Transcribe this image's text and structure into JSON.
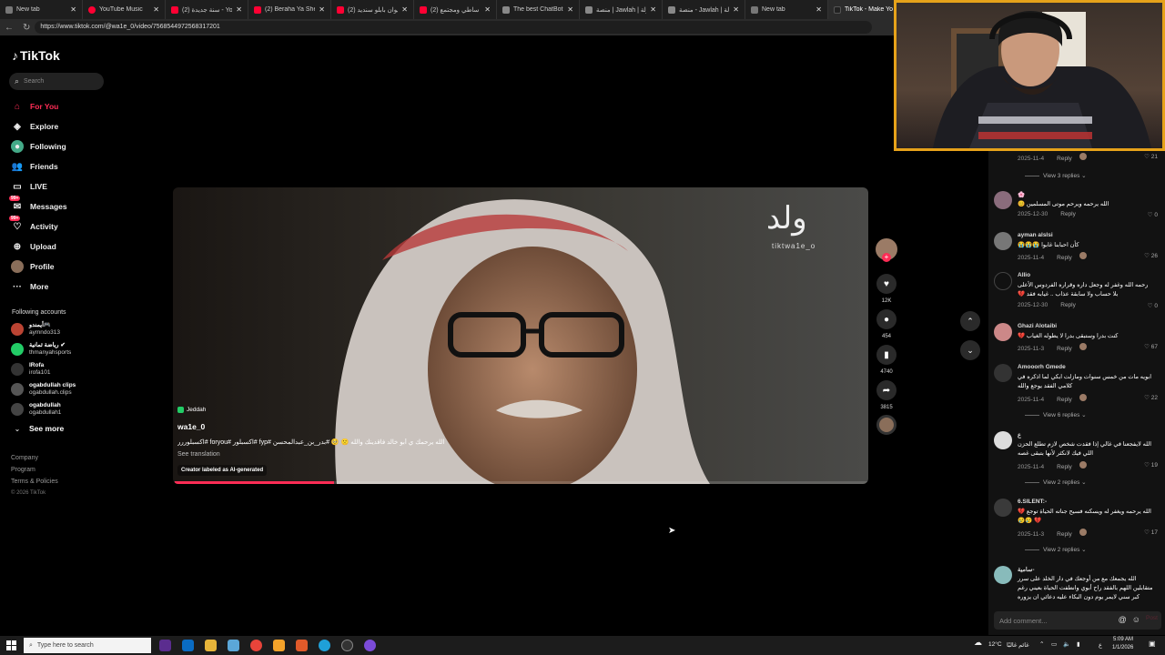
{
  "browser": {
    "tabs": [
      {
        "label": "New tab",
        "color": "#777"
      },
      {
        "label": "YouTube Music",
        "color": "#ff0033"
      },
      {
        "label": "(2) سنة جديدة - YouTube",
        "color": "#ff0033"
      },
      {
        "label": "(2) Beraha Ya Sheekh",
        "color": "#ff0033"
      },
      {
        "label": "(2) ميوان بابلو سنديد",
        "color": "#ff0033"
      },
      {
        "label": "(2) بلاك ساطي ومجتمع",
        "color": "#ff0033"
      },
      {
        "label": "The best ChatBot and",
        "color": "#888"
      },
      {
        "label": "منصة | Jawlah | جولة",
        "color": "#888"
      },
      {
        "label": "منصة - Jawlah | جولة",
        "color": "#888"
      },
      {
        "label": "New tab",
        "color": "#777"
      },
      {
        "label": "TikTok - Make Your D",
        "color": "#222",
        "active": true
      }
    ],
    "url": "https://www.tiktok.com/@wa1e_0/video/7568544972568317201"
  },
  "sidebar": {
    "logo": "TikTok",
    "search_placeholder": "Search",
    "nav": [
      {
        "label": "For You",
        "icon": "home-icon",
        "active": true
      },
      {
        "label": "Explore",
        "icon": "compass-icon"
      },
      {
        "label": "Following",
        "icon": "following-icon"
      },
      {
        "label": "Friends",
        "icon": "friends-icon"
      },
      {
        "label": "LIVE",
        "icon": "live-icon"
      },
      {
        "label": "Messages",
        "icon": "messages-icon",
        "badge": "99+"
      },
      {
        "label": "Activity",
        "icon": "activity-icon",
        "badge": "99+"
      },
      {
        "label": "Upload",
        "icon": "upload-icon"
      },
      {
        "label": "Profile",
        "icon": "profile-icon"
      },
      {
        "label": "More",
        "icon": "more-icon"
      }
    ],
    "following_title": "Following accounts",
    "accounts": [
      {
        "name": "أيمندو🎮",
        "handle": "aymndo313"
      },
      {
        "name": "رياضة ثمانية ✔",
        "handle": "thmanyahsports"
      },
      {
        "name": "IRofa",
        "handle": "irofa101"
      },
      {
        "name": "ogabdullah clips",
        "handle": "ogabdullah.clips"
      },
      {
        "name": "ogabdullah",
        "handle": "ogabdullah1"
      }
    ],
    "see_more": "See more",
    "footer": [
      "Company",
      "Program",
      "Terms & Policies",
      "© 2026 TikTok"
    ]
  },
  "video": {
    "watermark": "tiktwa1e_o",
    "location": "Jeddah",
    "author": "wa1e_0",
    "caption": "الله يرحمك ي أبو خالد فاقدينك والله 🙁 🥺 #بدر_بن_عبدالمحسن #fyp #اكسبلور #foryou #اكسبلوررر",
    "see_translation": "See translation",
    "ai_label": "Creator labeled as AI-generated",
    "progress_fraction": 0.23
  },
  "actions": {
    "likes": "12K",
    "comments": "454",
    "saves": "4740",
    "shares": "3815"
  },
  "comments": {
    "top_meta": {
      "date": "2025-11-4",
      "reply": "Reply",
      "likes": "21",
      "more": "View 3 replies"
    },
    "items": [
      {
        "name": "🌸",
        "text": "الله يرحمه ويرحم موتى المسلمين 😊",
        "date": "2025-12-30",
        "reply": "Reply",
        "likes": "0"
      },
      {
        "name": "ayman alslsi",
        "text": "كأن احبابنا غابوا 😭😭😭",
        "date": "2025-11-4",
        "reply": "Reply",
        "likes": "26"
      },
      {
        "name": "Allio",
        "text": "رحمه الله وغفر له وجعل داره وقراره الفردوس الأعلى بلا حساب ولا سابقة عذاب .. غيابه فقد 💔",
        "date": "2025-12-30",
        "reply": "Reply",
        "likes": "0"
      },
      {
        "name": "Ghazi Alotaibi",
        "text": "كنت بدرا وستبقى بدرا لا يطوله الغياب 💔",
        "date": "2025-11-3",
        "reply": "Reply",
        "likes": "67"
      },
      {
        "name": "Amooorh Gmede",
        "text": "ابويه مات من خمس سنوات ومازلت ابكي لما اذكره في كلامي الفقد يوجع والله",
        "date": "2025-11-4",
        "reply": "Reply",
        "likes": "22",
        "more": "View 6 replies"
      },
      {
        "name": "ع",
        "text": "الله لايفجعنا في غالي إذا فقدت شخص لازم تطلع الحزن اللي فيك لانكثر لأنها بتبقى غصه",
        "date": "2025-11-4",
        "reply": "Reply",
        "likes": "19",
        "more": "View 2 replies"
      },
      {
        "name": "6.SILENT:-",
        "text": "الله يرحمه ويغفر له ويسكنه فسيح جناته الحياة توجع 💔💔 😢😢",
        "date": "2025-11-3",
        "reply": "Reply",
        "likes": "17",
        "more": "View 2 replies"
      },
      {
        "name": "سامية-",
        "text": "الله يجمعك مع من أوجعك في دار الخلد على سرر متقابلين اللهم بالفقد راح أبوي وانطفت الحياة بعيني رغم كبر سني لايمر يوم دون البكاء عليه دعائي ان يزوره"
      }
    ],
    "add_placeholder": "Add comment...",
    "post_label": "Post"
  },
  "taskbar": {
    "search_placeholder": "Type here to search",
    "weather": "12°C",
    "weather_text": "غائم غالبًا",
    "lang": "ع",
    "time": "5:09 AM",
    "date": "1/1/2026"
  },
  "colors": {
    "accent": "#fe2c55",
    "cam_border": "#e6a21a"
  }
}
